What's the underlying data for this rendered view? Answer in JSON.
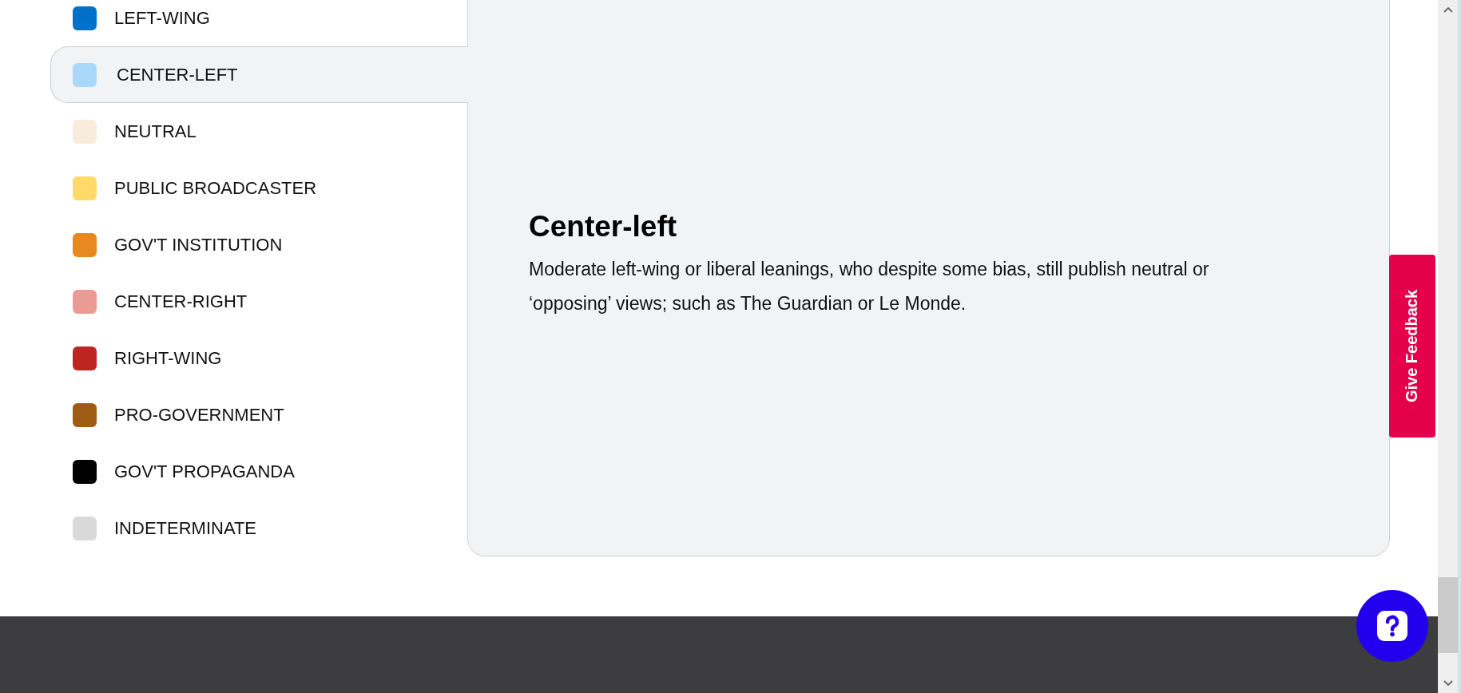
{
  "legend": {
    "items": [
      {
        "label": "LEFT-WING",
        "color": "#0070c9",
        "selected": false
      },
      {
        "label": "CENTER-LEFT",
        "color": "#a9d8fb",
        "selected": true
      },
      {
        "label": "NEUTRAL",
        "color": "#f8eddd",
        "selected": false
      },
      {
        "label": "PUBLIC BROADCASTER",
        "color": "#ffd96a",
        "selected": false
      },
      {
        "label": "GOV'T INSTITUTION",
        "color": "#e8891f",
        "selected": false
      },
      {
        "label": "CENTER-RIGHT",
        "color": "#ec9a94",
        "selected": false
      },
      {
        "label": "RIGHT-WING",
        "color": "#bd2620",
        "selected": false
      },
      {
        "label": "PRO-GOVERNMENT",
        "color": "#a05c14",
        "selected": false
      },
      {
        "label": "GOV'T PROPAGANDA",
        "color": "#000000",
        "selected": false
      },
      {
        "label": "INDETERMINATE",
        "color": "#d9d9d9",
        "selected": false
      }
    ]
  },
  "detail": {
    "title": "Center-left",
    "description": "Moderate left-wing or liberal leanings, who despite some bias, still publish neutral or ‘opposing’ views; such as The Guardian or Le Monde."
  },
  "feedback_button": {
    "label": "Give Feedback"
  }
}
